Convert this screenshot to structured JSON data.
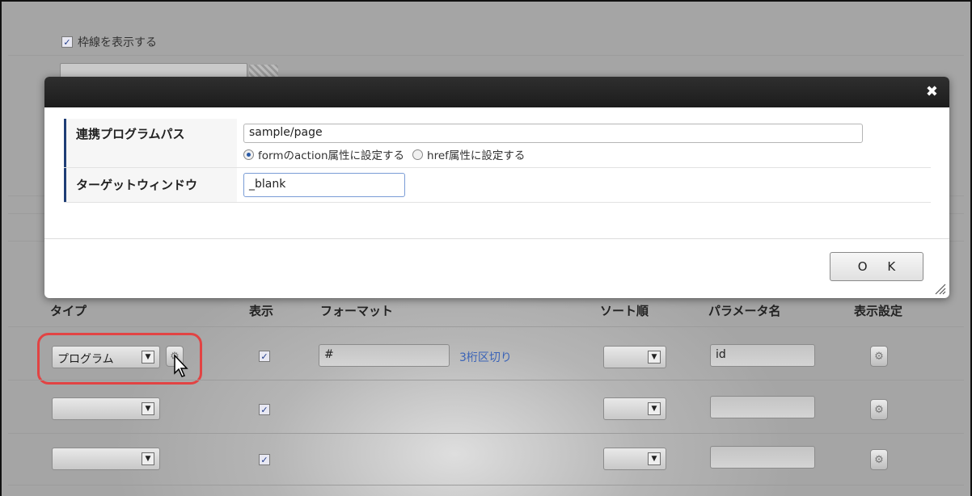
{
  "background": {
    "border_checkbox_label": "枠線を表示する",
    "border_checkbox_checked": true
  },
  "modal": {
    "close_symbol": "✖",
    "fields": [
      {
        "label": "連携プログラムパス",
        "value": "sample/page"
      },
      {
        "label": "ターゲットウィンドウ",
        "value": "_blank"
      }
    ],
    "radio_options": [
      {
        "label": "formのaction属性に設定する",
        "selected": true
      },
      {
        "label": "href属性に設定する",
        "selected": false
      }
    ],
    "ok_label": "O K"
  },
  "table": {
    "headers": {
      "type": "タイプ",
      "display": "表示",
      "format": "フォーマット",
      "sort": "ソート順",
      "param": "パラメータ名",
      "display_setting": "表示設定"
    },
    "rows": [
      {
        "type": "プログラム",
        "display": true,
        "format": "#",
        "format_link": "3桁区切り",
        "sort": "",
        "param": "id"
      },
      {
        "type": "",
        "display": true,
        "format": "",
        "format_link": "",
        "sort": "",
        "param": ""
      },
      {
        "type": "",
        "display": true,
        "format": "",
        "format_link": "",
        "sort": "",
        "param": ""
      }
    ]
  },
  "icons": {
    "gear": "gear-icon",
    "dropdown": "chevron-down-icon",
    "check": "checkmark-icon",
    "cursor": "mouse-pointer-icon"
  },
  "colors": {
    "highlight": "#e24343",
    "link": "#3a63b7",
    "modal_header": "#1c1c1c"
  }
}
